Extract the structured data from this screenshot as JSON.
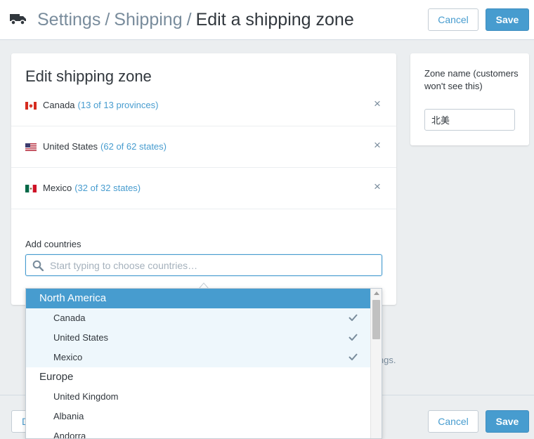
{
  "header": {
    "breadcrumb": [
      {
        "label": "Settings"
      },
      {
        "label": "Shipping"
      }
    ],
    "separator": "/",
    "current": "Edit a shipping zone",
    "cancel_label": "Cancel",
    "save_label": "Save"
  },
  "zone_card": {
    "title": "Edit shipping zone",
    "zones": [
      {
        "country": "Canada",
        "count": "(13 of 13 provinces)",
        "flag": "canada-flag-icon"
      },
      {
        "country": "United States",
        "count": "(62 of 62 states)",
        "flag": "usa-flag-icon"
      },
      {
        "country": "Mexico",
        "count": "(32 of 32 states)",
        "flag": "mexico-flag-icon"
      }
    ],
    "remove_glyph": "×",
    "add_countries_label": "Add countries",
    "search": {
      "placeholder": "Start typing to choose countries…",
      "value": ""
    }
  },
  "zone_name_card": {
    "label": "Zone name (customers won't see this)",
    "value": "北美"
  },
  "background_text": "ings.",
  "dropdown": {
    "groups": [
      {
        "label": "North America",
        "active": true,
        "items": [
          {
            "label": "Canada",
            "selected": true
          },
          {
            "label": "United States",
            "selected": true
          },
          {
            "label": "Mexico",
            "selected": true
          }
        ]
      },
      {
        "label": "Europe",
        "active": false,
        "items": [
          {
            "label": "United Kingdom",
            "selected": false
          },
          {
            "label": "Albania",
            "selected": false
          },
          {
            "label": "Andorra",
            "selected": false
          }
        ]
      }
    ]
  },
  "footer": {
    "delete_label": "D",
    "cancel_label": "Cancel",
    "save_label": "Save"
  },
  "colors": {
    "accent": "#479ccf",
    "background": "#ebeef0",
    "text": "#31373d",
    "muted": "#798c9c"
  }
}
